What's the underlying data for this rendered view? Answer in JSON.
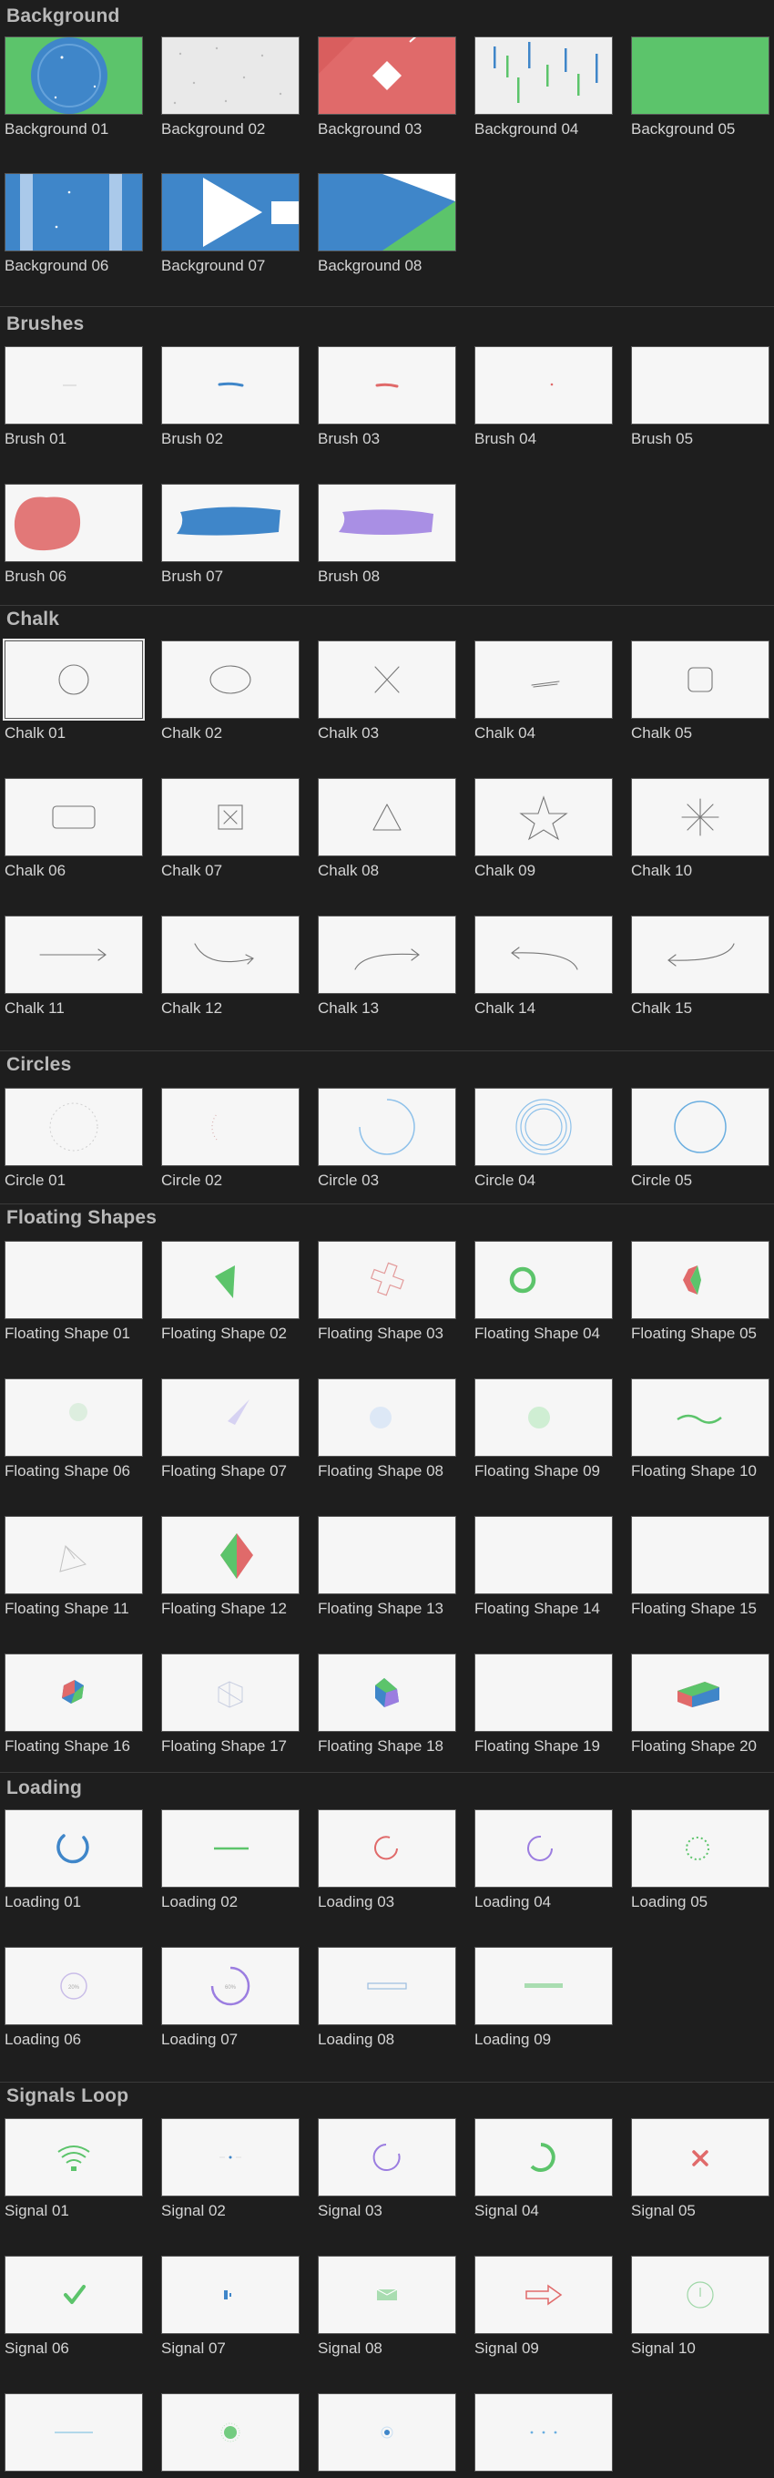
{
  "sections": [
    {
      "id": "background",
      "title": "Background",
      "items": [
        {
          "label": "Background 01",
          "kind": "bg01"
        },
        {
          "label": "Background 02",
          "kind": "bg02"
        },
        {
          "label": "Background 03",
          "kind": "bg03"
        },
        {
          "label": "Background 04",
          "kind": "bg04"
        },
        {
          "label": "Background 05",
          "kind": "bg05"
        },
        {
          "label": "Background 06",
          "kind": "bg06"
        },
        {
          "label": "Background 07",
          "kind": "bg07"
        },
        {
          "label": "Background 08",
          "kind": "bg08"
        }
      ]
    },
    {
      "id": "brushes",
      "title": "Brushes",
      "items": [
        {
          "label": "Brush 01",
          "kind": "brush01"
        },
        {
          "label": "Brush 02",
          "kind": "brush02"
        },
        {
          "label": "Brush 03",
          "kind": "brush03"
        },
        {
          "label": "Brush 04",
          "kind": "brush04"
        },
        {
          "label": "Brush 05",
          "kind": "blank"
        },
        {
          "label": "Brush 06",
          "kind": "brush06"
        },
        {
          "label": "Brush 07",
          "kind": "brush07"
        },
        {
          "label": "Brush 08",
          "kind": "brush08"
        }
      ]
    },
    {
      "id": "chalk",
      "title": "Chalk",
      "items": [
        {
          "label": "Chalk 01",
          "kind": "chalk01",
          "selected": true
        },
        {
          "label": "Chalk 02",
          "kind": "chalk02"
        },
        {
          "label": "Chalk 03",
          "kind": "chalk03"
        },
        {
          "label": "Chalk 04",
          "kind": "chalk04"
        },
        {
          "label": "Chalk 05",
          "kind": "chalk05"
        },
        {
          "label": "Chalk 06",
          "kind": "chalk06"
        },
        {
          "label": "Chalk 07",
          "kind": "chalk07"
        },
        {
          "label": "Chalk 08",
          "kind": "chalk08"
        },
        {
          "label": "Chalk 09",
          "kind": "chalk09"
        },
        {
          "label": "Chalk 10",
          "kind": "chalk10"
        },
        {
          "label": "Chalk 11",
          "kind": "chalk11"
        },
        {
          "label": "Chalk 12",
          "kind": "chalk12"
        },
        {
          "label": "Chalk 13",
          "kind": "chalk13"
        },
        {
          "label": "Chalk 14",
          "kind": "chalk14"
        },
        {
          "label": "Chalk 15",
          "kind": "chalk15"
        }
      ]
    },
    {
      "id": "circles",
      "title": "Circles",
      "items": [
        {
          "label": "Circle 01",
          "kind": "circle01"
        },
        {
          "label": "Circle 02",
          "kind": "circle02"
        },
        {
          "label": "Circle 03",
          "kind": "circle03"
        },
        {
          "label": "Circle 04",
          "kind": "circle04"
        },
        {
          "label": "Circle 05",
          "kind": "circle05"
        }
      ]
    },
    {
      "id": "floating",
      "title": "Floating Shapes",
      "items": [
        {
          "label": "Floating Shape 01",
          "kind": "blank"
        },
        {
          "label": "Floating Shape 02",
          "kind": "fs02"
        },
        {
          "label": "Floating Shape 03",
          "kind": "fs03"
        },
        {
          "label": "Floating Shape 04",
          "kind": "fs04"
        },
        {
          "label": "Floating Shape 05",
          "kind": "fs05"
        },
        {
          "label": "Floating Shape 06",
          "kind": "fs06"
        },
        {
          "label": "Floating Shape 07",
          "kind": "fs07"
        },
        {
          "label": "Floating Shape 08",
          "kind": "fs08"
        },
        {
          "label": "Floating Shape 09",
          "kind": "fs09"
        },
        {
          "label": "Floating Shape 10",
          "kind": "fs10"
        },
        {
          "label": "Floating Shape 11",
          "kind": "fs11"
        },
        {
          "label": "Floating Shape 12",
          "kind": "fs12"
        },
        {
          "label": "Floating Shape 13",
          "kind": "blank"
        },
        {
          "label": "Floating Shape 14",
          "kind": "blank"
        },
        {
          "label": "Floating Shape 15",
          "kind": "blank"
        },
        {
          "label": "Floating Shape 16",
          "kind": "fs16"
        },
        {
          "label": "Floating Shape 17",
          "kind": "fs17"
        },
        {
          "label": "Floating Shape 18",
          "kind": "fs18"
        },
        {
          "label": "Floating Shape 19",
          "kind": "blank"
        },
        {
          "label": "Floating Shape 20",
          "kind": "fs20"
        }
      ]
    },
    {
      "id": "loading",
      "title": "Loading",
      "items": [
        {
          "label": "Loading 01",
          "kind": "ld01"
        },
        {
          "label": "Loading 02",
          "kind": "ld02"
        },
        {
          "label": "Loading 03",
          "kind": "ld03"
        },
        {
          "label": "Loading 04",
          "kind": "ld04"
        },
        {
          "label": "Loading 05",
          "kind": "ld05"
        },
        {
          "label": "Loading 06",
          "kind": "ld06"
        },
        {
          "label": "Loading 07",
          "kind": "ld07"
        },
        {
          "label": "Loading 08",
          "kind": "ld08"
        },
        {
          "label": "Loading 09",
          "kind": "ld09"
        }
      ]
    },
    {
      "id": "signals",
      "title": "Signals Loop",
      "items": [
        {
          "label": "Signal 01",
          "kind": "sg01"
        },
        {
          "label": "Signal 02",
          "kind": "sg02"
        },
        {
          "label": "Signal 03",
          "kind": "sg03"
        },
        {
          "label": "Signal 04",
          "kind": "sg04"
        },
        {
          "label": "Signal 05",
          "kind": "sg05"
        },
        {
          "label": "Signal 06",
          "kind": "sg06"
        },
        {
          "label": "Signal 07",
          "kind": "sg07"
        },
        {
          "label": "Signal 08",
          "kind": "sg08"
        },
        {
          "label": "Signal 09",
          "kind": "sg09"
        },
        {
          "label": "Signal 10",
          "kind": "sg10"
        },
        {
          "label": "",
          "kind": "sg11"
        },
        {
          "label": "",
          "kind": "sg12"
        },
        {
          "label": "",
          "kind": "sg13"
        },
        {
          "label": "",
          "kind": "sg14"
        }
      ]
    }
  ],
  "colors": {
    "blue": "#3f86c9",
    "green": "#5cc46b",
    "red": "#e06a6a",
    "purple": "#9b7de0",
    "bg": "#1e1e1e"
  }
}
